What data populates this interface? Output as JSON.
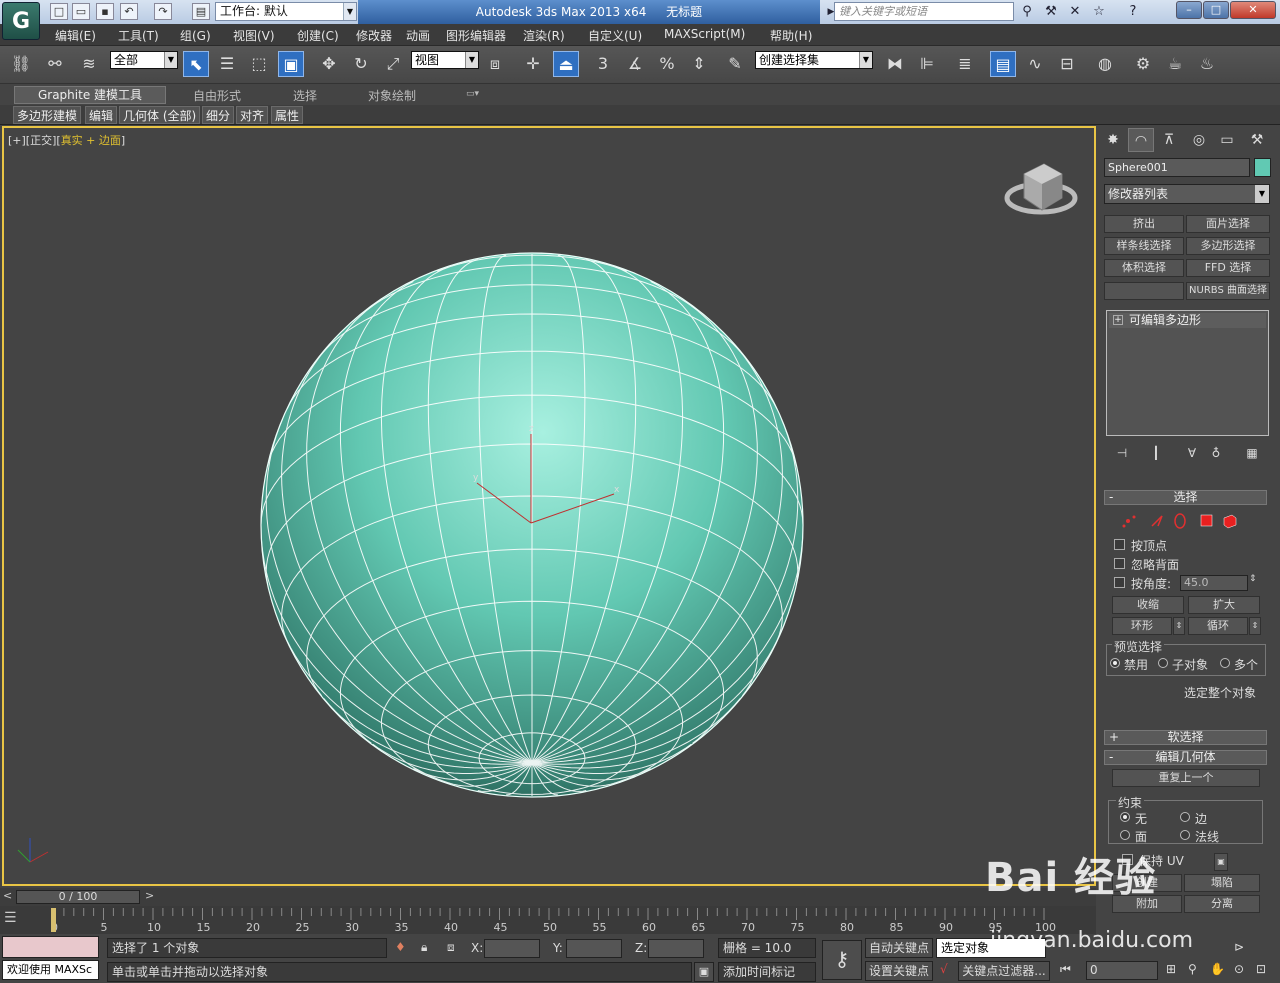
{
  "title_bar": {
    "workspace": "工作台: 默认",
    "app_name": "Autodesk 3ds Max  2013 x64",
    "doc_name": "无标题",
    "search_placeholder": "键入关键字或短语"
  },
  "menu": {
    "items": [
      "编辑(E)",
      "工具(T)",
      "组(G)",
      "视图(V)",
      "创建(C)",
      "修改器",
      "动画",
      "图形编辑器",
      "渲染(R)",
      "自定义(U)",
      "MAXScript(M)",
      "帮助(H)"
    ]
  },
  "toolbar": {
    "selection_filter": "全部",
    "ref_coord": "视图",
    "named_selection": "创建选择集",
    "snap_3": "3",
    "snap_percent": "%"
  },
  "ribbon": {
    "tabs": [
      "Graphite 建模工具",
      "自由形式",
      "选择",
      "对象绘制"
    ],
    "sub_tabs": [
      "多边形建模",
      "编辑",
      "几何体 (全部)",
      "细分",
      "对齐",
      "属性"
    ]
  },
  "viewport": {
    "label_prefix": "[+][正交][",
    "label_shading": "真实 + 边面",
    "label_suffix": "]",
    "gizmo_x": "x",
    "gizmo_y": "y",
    "gizmo_z": "z",
    "object_color": "#61c9b3"
  },
  "command_panel": {
    "object_name": "Sphere001",
    "modifier_list": "修改器列表",
    "modifier_buttons": [
      "挤出",
      "面片选择",
      "样条线选择",
      "多边形选择",
      "体积选择",
      "FFD 选择",
      "",
      "NURBS 曲面选择"
    ],
    "stack_item": "可编辑多边形",
    "selection_rollout": "选择",
    "by_vertex": "按顶点",
    "ignore_backfacing": "忽略背面",
    "by_angle": "按角度:",
    "angle_value": "45.0",
    "shrink": "收缩",
    "grow": "扩大",
    "ring": "环形",
    "loop": "循环",
    "preview_selection": "预览选择",
    "preview_options": [
      "禁用",
      "子对象",
      "多个"
    ],
    "select_whole": "选定整个对象",
    "soft_selection": "软选择",
    "edit_geometry": "编辑几何体",
    "repeat_last": "重复上一个",
    "constraints": "约束",
    "constraint_options": [
      "无",
      "边",
      "面",
      "法线"
    ],
    "preserve_uv": "保持 UV",
    "create": "创建",
    "collapse": "塌陷",
    "attach": "附加",
    "detach": "分离"
  },
  "timeline": {
    "frame_display": "0 / 100",
    "ticks": [
      "0",
      "5",
      "10",
      "15",
      "20",
      "25",
      "30",
      "35",
      "40",
      "45",
      "50",
      "55",
      "60",
      "65",
      "70",
      "75",
      "80",
      "85",
      "90",
      "95",
      "100"
    ]
  },
  "status_bar": {
    "maxscript_label": "欢迎使用 MAXSc",
    "selection_status": "选择了 1 个对象",
    "prompt": "单击或单击并拖动以选择对象",
    "x_label": "X:",
    "y_label": "Y:",
    "z_label": "Z:",
    "grid": "栅格 = 10.0",
    "add_time_tag": "添加时间标记",
    "auto_key": "自动关键点",
    "set_key": "设置关键点",
    "selected_object": "选定对象",
    "key_filters": "关键点过滤器...",
    "current_frame": "0"
  },
  "watermark": {
    "text": "Bai 经验",
    "url": "jingyan.baidu.com"
  }
}
